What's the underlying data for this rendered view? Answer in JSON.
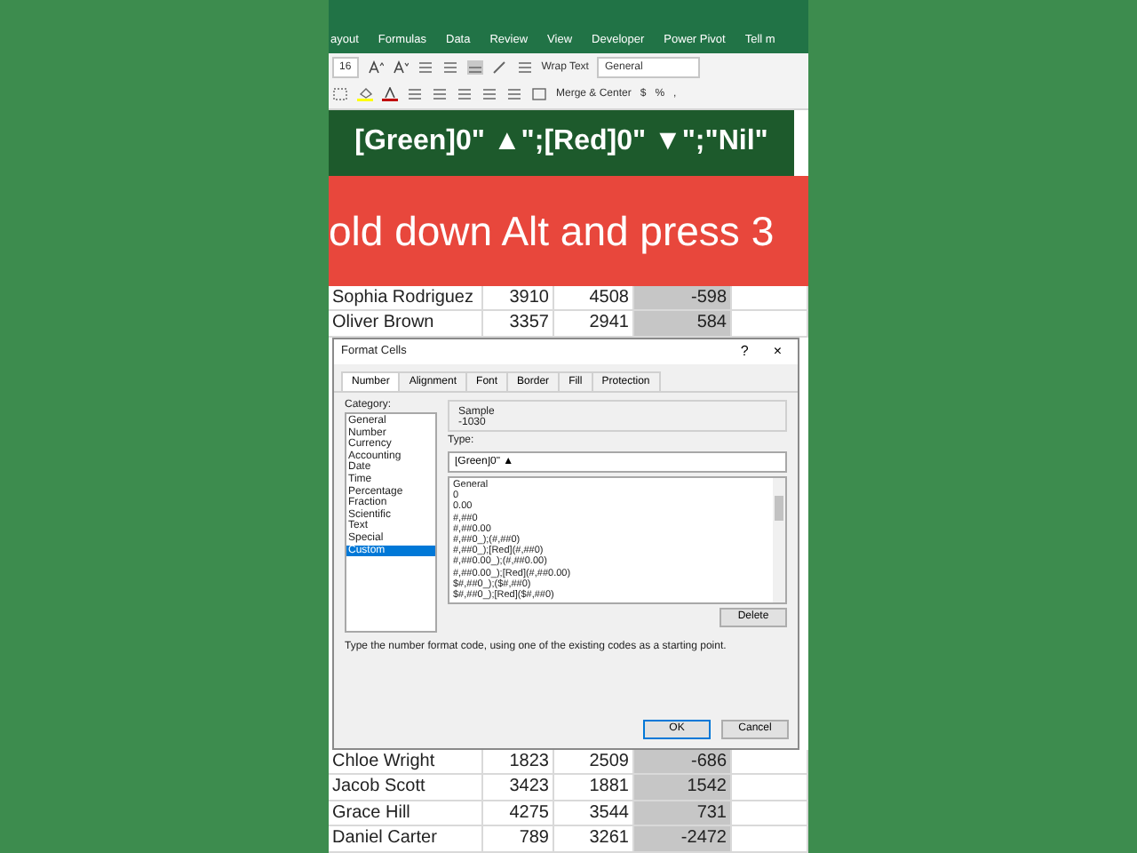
{
  "ribbon": {
    "tabs": [
      {
        "label": "ayout",
        "selected": false
      },
      {
        "label": "Formulas",
        "selected": false
      },
      {
        "label": "Data",
        "selected": false
      },
      {
        "label": "Review",
        "selected": false
      },
      {
        "label": "View",
        "selected": false
      },
      {
        "label": "Developer",
        "selected": false
      },
      {
        "label": "Power Pivot",
        "selected": false
      },
      {
        "label": "Tell m",
        "selected": false
      }
    ],
    "font_size": "16",
    "wrap_text": "Wrap Text",
    "merge_center": "Merge & Center",
    "number_format": "General",
    "currency": "$",
    "percent": "%",
    "comma": ","
  },
  "caption": "[Green]0\" ▲\";[Red]0\" ▼\";\"Nil\"",
  "banner": "old down Alt and press 3",
  "rows_top": [
    {
      "name": "Sophia Rodriguez",
      "d": "3910",
      "e": "4508",
      "f": "-598"
    },
    {
      "name": "Oliver Brown",
      "d": "3357",
      "e": "2941",
      "f": "584"
    }
  ],
  "dialog": {
    "title": "Format Cells",
    "help": "?",
    "close": "×",
    "tabs": [
      {
        "label": "Number",
        "selected": true
      },
      {
        "label": "Alignment",
        "selected": false
      },
      {
        "label": "Font",
        "selected": false
      },
      {
        "label": "Border",
        "selected": false
      },
      {
        "label": "Fill",
        "selected": false
      },
      {
        "label": "Protection",
        "selected": false
      }
    ],
    "category_label": "Category:",
    "categories": [
      {
        "label": "General",
        "selected": false
      },
      {
        "label": "Number",
        "selected": false
      },
      {
        "label": "Currency",
        "selected": false
      },
      {
        "label": "Accounting",
        "selected": false
      },
      {
        "label": "Date",
        "selected": false
      },
      {
        "label": "Time",
        "selected": false
      },
      {
        "label": "Percentage",
        "selected": false
      },
      {
        "label": "Fraction",
        "selected": false
      },
      {
        "label": "Scientific",
        "selected": false
      },
      {
        "label": "Text",
        "selected": false
      },
      {
        "label": "Special",
        "selected": false
      },
      {
        "label": "Custom",
        "selected": true
      }
    ],
    "sample_label": "Sample",
    "sample": "-1030",
    "type_label": "Type:",
    "type_value": "[Green]0\" ▲",
    "formats": [
      "General",
      "0",
      "0.00",
      "#,##0",
      "#,##0.00",
      "#,##0_);(#,##0)",
      "#,##0_);[Red](#,##0)",
      "#,##0.00_);(#,##0.00)",
      "#,##0.00_);[Red](#,##0.00)",
      "$#,##0_);($#,##0)",
      "$#,##0_);[Red]($#,##0)"
    ],
    "delete": "Delete",
    "hint": "Type the number format code, using one of the existing codes as a starting point.",
    "ok": "OK",
    "cancel": "Cancel"
  },
  "rows_bottom": [
    {
      "name": "Chloe Wright",
      "d": "1823",
      "e": "2509",
      "f": "-686"
    },
    {
      "name": "Jacob Scott",
      "d": "3423",
      "e": "1881",
      "f": "1542"
    },
    {
      "name": "Grace Hill",
      "d": "4275",
      "e": "3544",
      "f": "731"
    },
    {
      "name": "Daniel Carter",
      "d": "789",
      "e": "3261",
      "f": "-2472"
    }
  ]
}
